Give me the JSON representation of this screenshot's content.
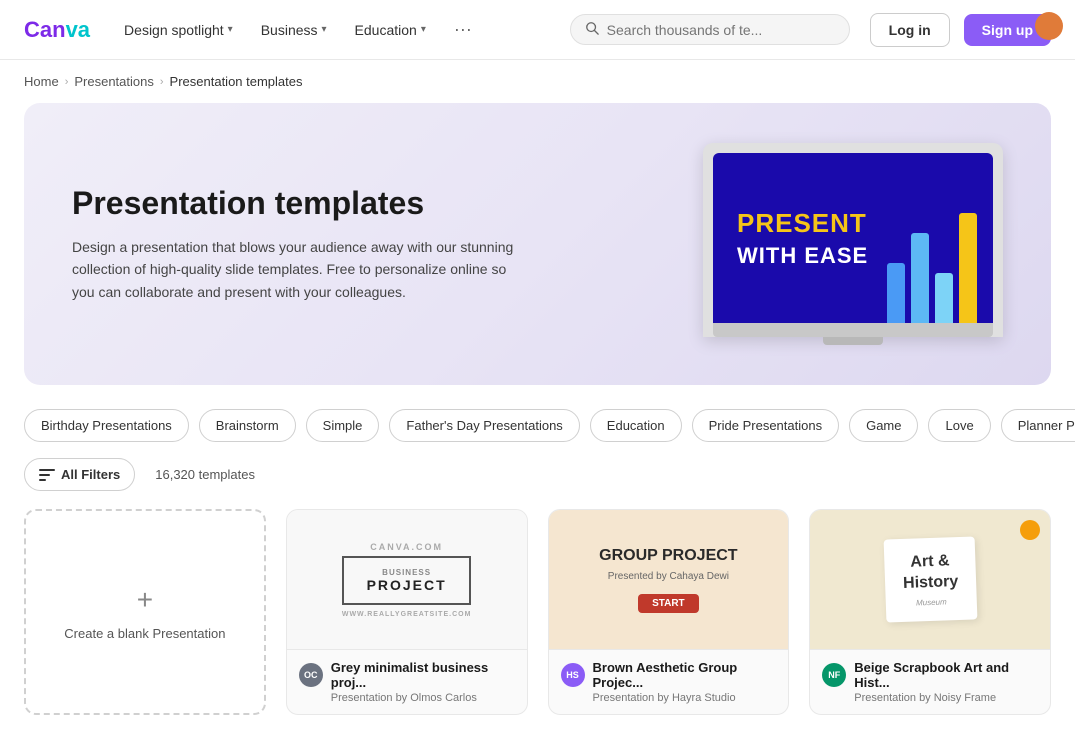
{
  "nav": {
    "logo": "Canva",
    "items": [
      {
        "label": "Design spotlight",
        "hasDropdown": true
      },
      {
        "label": "Business",
        "hasDropdown": true
      },
      {
        "label": "Education",
        "hasDropdown": true
      }
    ],
    "more_label": "···",
    "search_placeholder": "Search thousands of te...",
    "login_label": "Log in",
    "signup_label": "Sign up"
  },
  "breadcrumb": {
    "items": [
      {
        "label": "Home",
        "href": "#"
      },
      {
        "label": "Presentations",
        "href": "#"
      },
      {
        "label": "Presentation templates",
        "current": true
      }
    ]
  },
  "hero": {
    "title": "Presentation templates",
    "description": "Design a presentation that blows your audience away with our stunning collection of high-quality slide templates. Free to personalize online so you can collaborate and present with your colleagues.",
    "laptop": {
      "line1": "PRESENT",
      "line2": "WITH EASE"
    }
  },
  "tags": [
    "Birthday Presentations",
    "Brainstorm",
    "Simple",
    "Father's Day Presentations",
    "Education",
    "Pride Presentations",
    "Game",
    "Love",
    "Planner Presentations"
  ],
  "filters": {
    "all_filters_label": "All Filters",
    "template_count": "16,320 templates"
  },
  "cards": [
    {
      "type": "blank",
      "label": "Create a blank Presentation"
    },
    {
      "type": "template",
      "thumb_type": "business",
      "title": "Grey minimalist business proj...",
      "author": "Presentation by Olmos Carlos",
      "avatar_color": "#6b7280",
      "avatar_initials": "OC"
    },
    {
      "type": "template",
      "thumb_type": "group",
      "title": "Brown Aesthetic Group Projec...",
      "author": "Presentation by Hayra Studio",
      "avatar_color": "#8b5cf6",
      "avatar_initials": "HS"
    },
    {
      "type": "template",
      "thumb_type": "art",
      "title": "Beige Scrapbook Art and Hist...",
      "author": "Presentation by Noisy Frame",
      "avatar_color": "#059669",
      "avatar_initials": "NF"
    }
  ]
}
